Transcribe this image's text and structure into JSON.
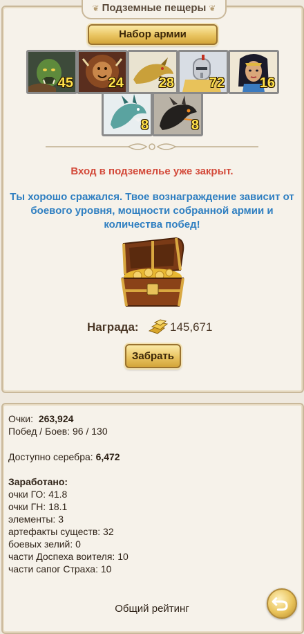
{
  "header": {
    "title": "Подземные пещеры"
  },
  "army_button": {
    "label": "Набор армии"
  },
  "units": [
    {
      "name": "orc-warrior",
      "count": "45"
    },
    {
      "name": "lion-beast",
      "count": "24"
    },
    {
      "name": "golden-dragon",
      "count": "28"
    },
    {
      "name": "armored-knight",
      "count": "72"
    },
    {
      "name": "egyptian-queen",
      "count": "16"
    },
    {
      "name": "ice-dragon",
      "count": "8"
    },
    {
      "name": "black-dragon",
      "count": "8"
    }
  ],
  "messages": {
    "closed": "Вход в подземелье уже закрыт.",
    "info": "Ты хорошо сражался. Твое вознаграждение зависит от боевого уровня, мощности собранной армии и количества побед!"
  },
  "reward": {
    "label": "Награда:",
    "value": "145,671",
    "icon": "silver-bars-icon"
  },
  "claim_button": {
    "label": "Забрать"
  },
  "stats": {
    "points_label": "Очки:",
    "points_value": "263,924",
    "wins_line": "Побед / Боев: 96 / 130",
    "silver_label": "Доступно серебра:",
    "silver_value": "6,472",
    "earned_label": "Заработано:",
    "earned_items": [
      "очки ГО: 41.8",
      "очки ГН: 18.1",
      "элементы: 3",
      "артефакты существ: 32",
      "боевых зелий: 0",
      "части Доспеха воителя: 10",
      "части сапог Страха: 10"
    ]
  },
  "rating": {
    "title": "Общий рейтинг"
  },
  "colors": {
    "closed_text": "#d34a3a",
    "info_text": "#2f7fc1",
    "count_text": "#ffe14a",
    "button_gold": "#e9c461"
  }
}
